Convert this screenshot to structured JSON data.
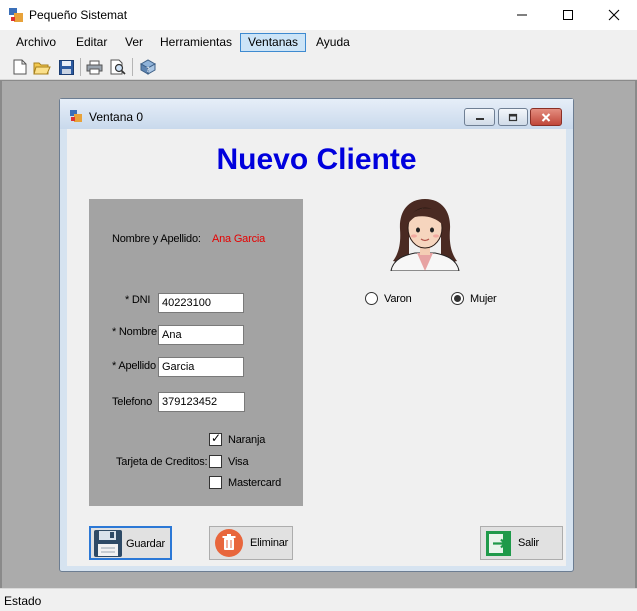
{
  "window": {
    "title": "Pequeño Sistemat"
  },
  "menu": {
    "items": [
      {
        "label": "Archivo"
      },
      {
        "label": "Editar"
      },
      {
        "label": "Ver"
      },
      {
        "label": "Herramientas"
      },
      {
        "label": "Ventanas",
        "active": true
      },
      {
        "label": "Ayuda"
      }
    ]
  },
  "toolbar": {
    "icons": [
      "new-document-icon",
      "open-folder-icon",
      "save-icon",
      "print-icon",
      "print-preview-icon",
      "help-icon"
    ]
  },
  "child_window": {
    "title": "Ventana 0",
    "heading": "Nuevo Cliente",
    "form": {
      "nombre_apellido_label": "Nombre y Apellido:",
      "nombre_apellido_value": "Ana Garcia",
      "dni_label": "* DNI",
      "dni_value": "40223100",
      "nombre_label": "* Nombre",
      "nombre_value": "Ana",
      "apellido_label": "* Apellido",
      "apellido_value": "Garcia",
      "telefono_label": "Telefono",
      "telefono_value": "379123452",
      "tarjeta_label": "Tarjeta de Creditos:",
      "tarjetas": [
        {
          "label": "Naranja",
          "checked": true
        },
        {
          "label": "Visa",
          "checked": false
        },
        {
          "label": "Mastercard",
          "checked": false
        }
      ]
    },
    "gender": {
      "options": [
        {
          "label": "Varon",
          "selected": false
        },
        {
          "label": "Mujer",
          "selected": true
        }
      ]
    },
    "buttons": {
      "guardar": "Guardar",
      "eliminar": "Eliminar",
      "salir": "Salir"
    }
  },
  "status": {
    "text": "Estado"
  },
  "colors": {
    "heading": "#0000dd",
    "accent_value": "#e60000",
    "panel": "#a3a3a3",
    "active_menu": "#cce4f7"
  }
}
